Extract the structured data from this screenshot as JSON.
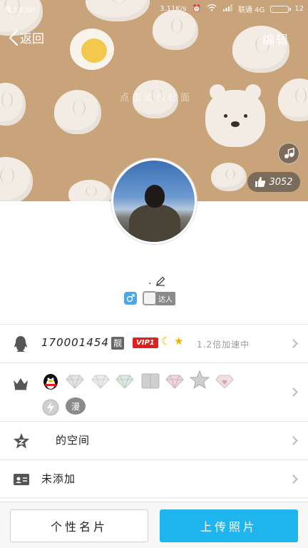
{
  "status_bar": {
    "time": "晚上8:50",
    "network_speed": "3.11K/s",
    "carrier": "联通 4G",
    "battery": "12"
  },
  "nav": {
    "back_label": "返回",
    "edit_label": "编辑"
  },
  "cover": {
    "watermark": "点击更换封面",
    "like_count": "3052"
  },
  "profile": {
    "nickname": "."
  },
  "badges": {
    "talent_label": "达人"
  },
  "rows": {
    "qq": {
      "number": "170001454",
      "liang_tag": "靓",
      "vip_tag": "VIP1",
      "accel_text": "1.2倍加速中"
    },
    "space": {
      "text": "的空间"
    },
    "card": {
      "text": "未添加"
    }
  },
  "vip_icons": [
    "qq-penguin-icon",
    "diamond-icon",
    "diamond-icon",
    "diamond-icon",
    "book-icon",
    "diamond-pink-icon",
    "star-icon",
    "heart-diamond-icon",
    "lightning-icon",
    "manman-icon"
  ],
  "badge_text": {
    "manman": "漫"
  },
  "bottom": {
    "card_button": "个性名片",
    "upload_button": "上传照片"
  },
  "colors": {
    "accent": "#1fb6f0",
    "cover_bg": "#c9a47a",
    "vip_red": "#e02020"
  }
}
